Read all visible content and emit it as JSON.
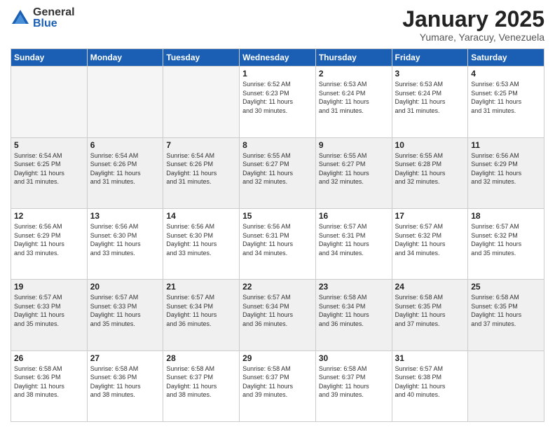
{
  "logo": {
    "general": "General",
    "blue": "Blue"
  },
  "title": "January 2025",
  "location": "Yumare, Yaracuy, Venezuela",
  "days_header": [
    "Sunday",
    "Monday",
    "Tuesday",
    "Wednesday",
    "Thursday",
    "Friday",
    "Saturday"
  ],
  "weeks": [
    [
      {
        "day": "",
        "info": ""
      },
      {
        "day": "",
        "info": ""
      },
      {
        "day": "",
        "info": ""
      },
      {
        "day": "1",
        "info": "Sunrise: 6:52 AM\nSunset: 6:23 PM\nDaylight: 11 hours\nand 30 minutes."
      },
      {
        "day": "2",
        "info": "Sunrise: 6:53 AM\nSunset: 6:24 PM\nDaylight: 11 hours\nand 31 minutes."
      },
      {
        "day": "3",
        "info": "Sunrise: 6:53 AM\nSunset: 6:24 PM\nDaylight: 11 hours\nand 31 minutes."
      },
      {
        "day": "4",
        "info": "Sunrise: 6:53 AM\nSunset: 6:25 PM\nDaylight: 11 hours\nand 31 minutes."
      }
    ],
    [
      {
        "day": "5",
        "info": "Sunrise: 6:54 AM\nSunset: 6:25 PM\nDaylight: 11 hours\nand 31 minutes."
      },
      {
        "day": "6",
        "info": "Sunrise: 6:54 AM\nSunset: 6:26 PM\nDaylight: 11 hours\nand 31 minutes."
      },
      {
        "day": "7",
        "info": "Sunrise: 6:54 AM\nSunset: 6:26 PM\nDaylight: 11 hours\nand 31 minutes."
      },
      {
        "day": "8",
        "info": "Sunrise: 6:55 AM\nSunset: 6:27 PM\nDaylight: 11 hours\nand 32 minutes."
      },
      {
        "day": "9",
        "info": "Sunrise: 6:55 AM\nSunset: 6:27 PM\nDaylight: 11 hours\nand 32 minutes."
      },
      {
        "day": "10",
        "info": "Sunrise: 6:55 AM\nSunset: 6:28 PM\nDaylight: 11 hours\nand 32 minutes."
      },
      {
        "day": "11",
        "info": "Sunrise: 6:56 AM\nSunset: 6:29 PM\nDaylight: 11 hours\nand 32 minutes."
      }
    ],
    [
      {
        "day": "12",
        "info": "Sunrise: 6:56 AM\nSunset: 6:29 PM\nDaylight: 11 hours\nand 33 minutes."
      },
      {
        "day": "13",
        "info": "Sunrise: 6:56 AM\nSunset: 6:30 PM\nDaylight: 11 hours\nand 33 minutes."
      },
      {
        "day": "14",
        "info": "Sunrise: 6:56 AM\nSunset: 6:30 PM\nDaylight: 11 hours\nand 33 minutes."
      },
      {
        "day": "15",
        "info": "Sunrise: 6:56 AM\nSunset: 6:31 PM\nDaylight: 11 hours\nand 34 minutes."
      },
      {
        "day": "16",
        "info": "Sunrise: 6:57 AM\nSunset: 6:31 PM\nDaylight: 11 hours\nand 34 minutes."
      },
      {
        "day": "17",
        "info": "Sunrise: 6:57 AM\nSunset: 6:32 PM\nDaylight: 11 hours\nand 34 minutes."
      },
      {
        "day": "18",
        "info": "Sunrise: 6:57 AM\nSunset: 6:32 PM\nDaylight: 11 hours\nand 35 minutes."
      }
    ],
    [
      {
        "day": "19",
        "info": "Sunrise: 6:57 AM\nSunset: 6:33 PM\nDaylight: 11 hours\nand 35 minutes."
      },
      {
        "day": "20",
        "info": "Sunrise: 6:57 AM\nSunset: 6:33 PM\nDaylight: 11 hours\nand 35 minutes."
      },
      {
        "day": "21",
        "info": "Sunrise: 6:57 AM\nSunset: 6:34 PM\nDaylight: 11 hours\nand 36 minutes."
      },
      {
        "day": "22",
        "info": "Sunrise: 6:57 AM\nSunset: 6:34 PM\nDaylight: 11 hours\nand 36 minutes."
      },
      {
        "day": "23",
        "info": "Sunrise: 6:58 AM\nSunset: 6:34 PM\nDaylight: 11 hours\nand 36 minutes."
      },
      {
        "day": "24",
        "info": "Sunrise: 6:58 AM\nSunset: 6:35 PM\nDaylight: 11 hours\nand 37 minutes."
      },
      {
        "day": "25",
        "info": "Sunrise: 6:58 AM\nSunset: 6:35 PM\nDaylight: 11 hours\nand 37 minutes."
      }
    ],
    [
      {
        "day": "26",
        "info": "Sunrise: 6:58 AM\nSunset: 6:36 PM\nDaylight: 11 hours\nand 38 minutes."
      },
      {
        "day": "27",
        "info": "Sunrise: 6:58 AM\nSunset: 6:36 PM\nDaylight: 11 hours\nand 38 minutes."
      },
      {
        "day": "28",
        "info": "Sunrise: 6:58 AM\nSunset: 6:37 PM\nDaylight: 11 hours\nand 38 minutes."
      },
      {
        "day": "29",
        "info": "Sunrise: 6:58 AM\nSunset: 6:37 PM\nDaylight: 11 hours\nand 39 minutes."
      },
      {
        "day": "30",
        "info": "Sunrise: 6:58 AM\nSunset: 6:37 PM\nDaylight: 11 hours\nand 39 minutes."
      },
      {
        "day": "31",
        "info": "Sunrise: 6:57 AM\nSunset: 6:38 PM\nDaylight: 11 hours\nand 40 minutes."
      },
      {
        "day": "",
        "info": ""
      }
    ]
  ]
}
